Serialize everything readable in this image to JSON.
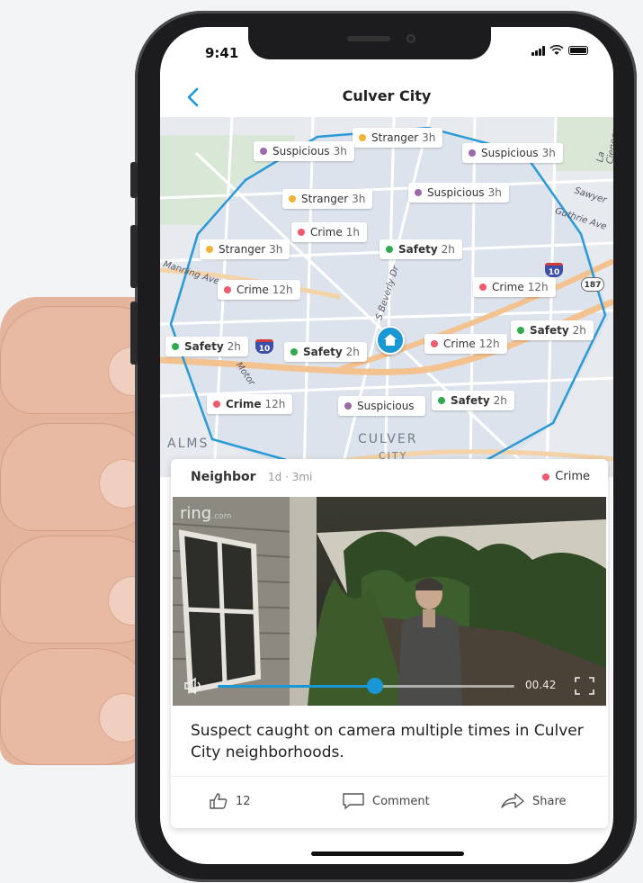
{
  "status_bar": {
    "time": "9:41"
  },
  "nav": {
    "title": "Culver City"
  },
  "map": {
    "area_label": "CULVER",
    "area_label_2": "CITY",
    "palms_label": "ALMS",
    "road_labels": [
      "S Beverly Dr",
      "Manning Ave",
      "Sawyer",
      "Guthrie Ave",
      "La Cienega",
      "Motor"
    ],
    "shield_labels": [
      "10",
      "10",
      "187"
    ],
    "chips": [
      {
        "category": "Stranger",
        "age": "3h",
        "color": "#f2b233",
        "bold": false
      },
      {
        "category": "Suspicious",
        "age": "3h",
        "color": "#9b6aa8",
        "bold": false
      },
      {
        "category": "Suspicious",
        "age": "3h",
        "color": "#9b6aa8",
        "bold": false
      },
      {
        "category": "Stranger",
        "age": "3h",
        "color": "#f2b233",
        "bold": false
      },
      {
        "category": "Suspicious",
        "age": "3h",
        "color": "#9b6aa8",
        "bold": false
      },
      {
        "category": "Crime",
        "age": "1h",
        "color": "#f05a6e",
        "bold": false
      },
      {
        "category": "Stranger",
        "age": "3h",
        "color": "#f2b233",
        "bold": false
      },
      {
        "category": "Safety",
        "age": "2h",
        "color": "#2eab4f",
        "bold": true
      },
      {
        "category": "Crime",
        "age": "12h",
        "color": "#f05a6e",
        "bold": false
      },
      {
        "category": "Crime",
        "age": "12h",
        "color": "#f05a6e",
        "bold": false
      },
      {
        "category": "Safety",
        "age": "2h",
        "color": "#2eab4f",
        "bold": true
      },
      {
        "category": "Safety",
        "age": "2h",
        "color": "#2eab4f",
        "bold": true
      },
      {
        "category": "Safety",
        "age": "2h",
        "color": "#2eab4f",
        "bold": true
      },
      {
        "category": "Crime",
        "age": "12h",
        "color": "#f05a6e",
        "bold": false
      },
      {
        "category": "Crime",
        "age": "12h",
        "color": "#f05a6e",
        "bold": true
      },
      {
        "category": "Suspicious",
        "age": "",
        "color": "#9b6aa8",
        "bold": false
      },
      {
        "category": "Safety",
        "age": "2h",
        "color": "#2eab4f",
        "bold": true
      }
    ]
  },
  "post": {
    "author": "Neighbor",
    "meta": "1d · 3mi",
    "tag": "Crime",
    "tag_color": "#f05a6e",
    "video_brand": "ring",
    "video_brand_suffix": ".com",
    "video_time": "00.42",
    "progress": 0.53,
    "caption": "Suspect caught on camera multiple times in Culver City neighborhoods.",
    "likes": "12",
    "comment_label": "Comment",
    "share_label": "Share"
  },
  "colors": {
    "accent": "#1998d5",
    "boundary": "#2a9ad6"
  }
}
